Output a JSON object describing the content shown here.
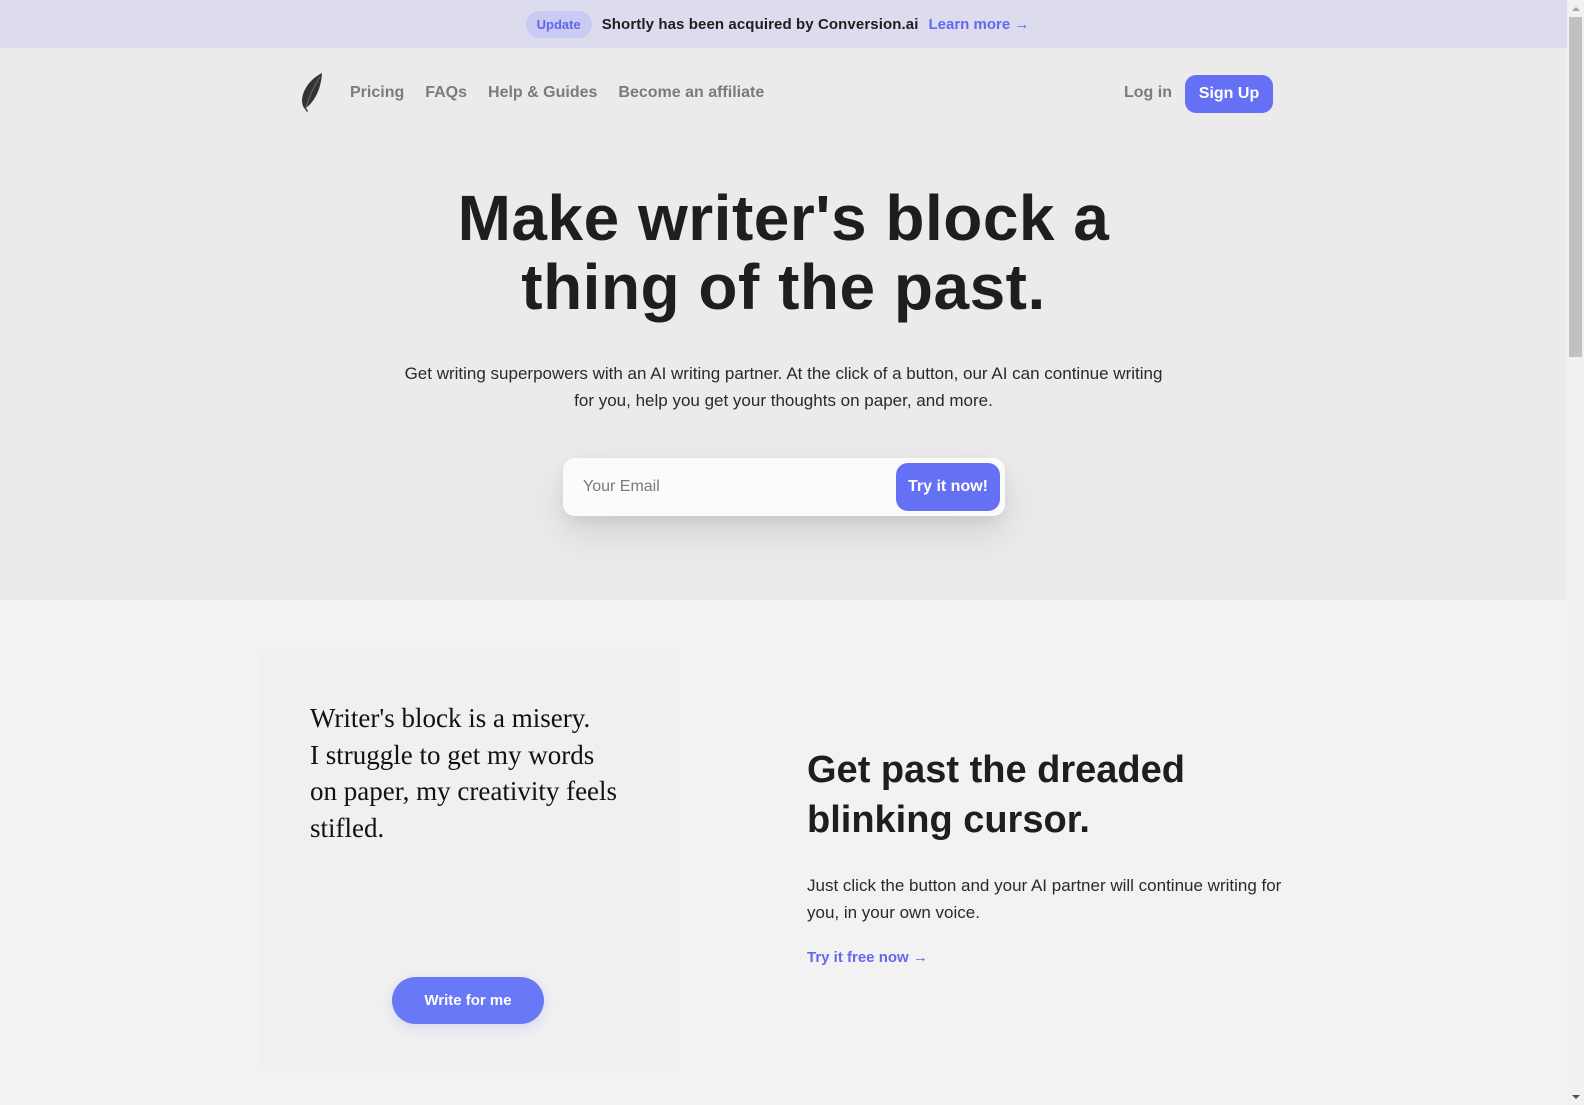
{
  "announcement": {
    "badge": "Update",
    "text": "Shortly has been acquired by Conversion.ai",
    "link": "Learn more →"
  },
  "nav": {
    "logo_icon": "feather-icon",
    "links": [
      {
        "label": "Pricing"
      },
      {
        "label": "FAQs"
      },
      {
        "label": "Help & Guides"
      },
      {
        "label": "Become an affiliate"
      }
    ],
    "login": "Log in",
    "signup": "Sign Up"
  },
  "hero": {
    "headline_line1": "Make writer's block a",
    "headline_line2": "thing of the past.",
    "subtext": "Get writing superpowers with an AI writing partner. At the click of a button, our AI can continue writing for you, help you get your thoughts on paper, and more.",
    "email_placeholder": "Your Email",
    "email_value": "",
    "cta": "Try it now!"
  },
  "feature": {
    "demo_lines": [
      "Writer's block is a misery.",
      "I struggle to get my words",
      "on paper, my creativity feels",
      "stifled."
    ],
    "demo_button": "Write for me",
    "title_line1": "Get past the dreaded",
    "title_line2": "blinking cursor.",
    "description": "Just click the button and your AI partner will continue writing for you, in your own voice.",
    "link": "Try it free now →"
  },
  "colors": {
    "accent": "#6570f5",
    "link": "#6368ee",
    "announce_bg": "#dcdcee",
    "hero_bg": "#ebebeb"
  }
}
